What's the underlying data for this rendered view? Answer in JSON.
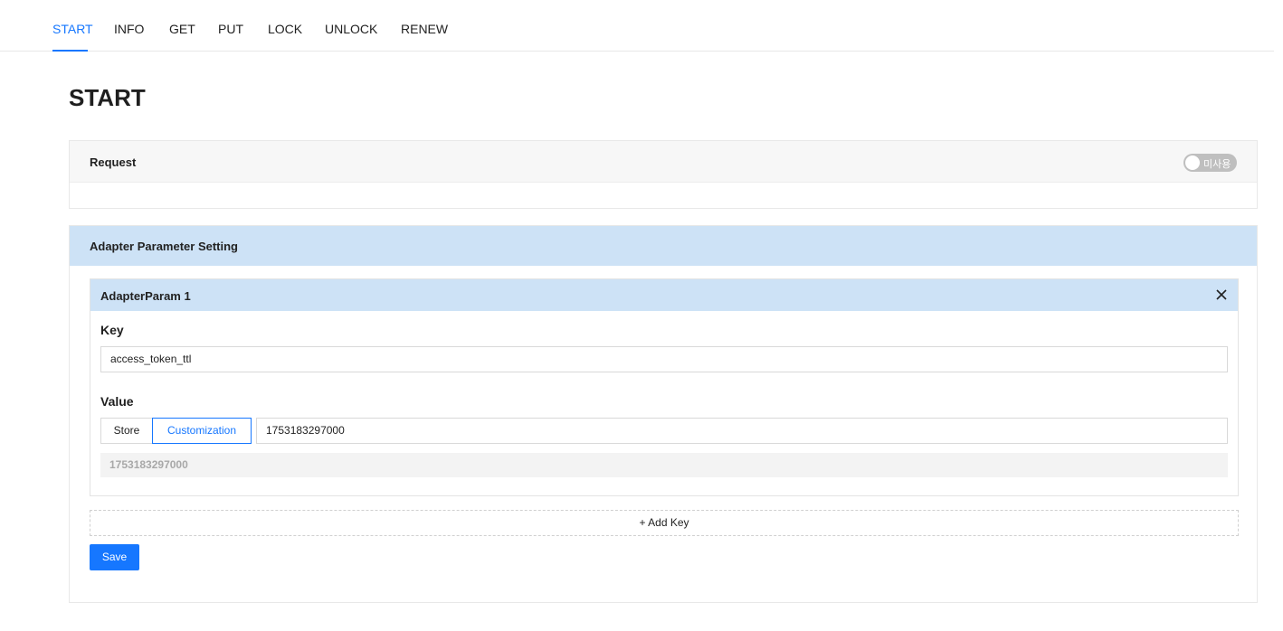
{
  "tabs": [
    {
      "label": "START",
      "active": true
    },
    {
      "label": "INFO"
    },
    {
      "label": "GET"
    },
    {
      "label": "PUT"
    },
    {
      "label": "LOCK"
    },
    {
      "label": "UNLOCK"
    },
    {
      "label": "RENEW"
    }
  ],
  "page_title": "START",
  "request": {
    "title": "Request",
    "toggle_label": "미사용",
    "toggle_on": false
  },
  "adapter": {
    "title": "Adapter Parameter Setting",
    "param": {
      "title": "AdapterParam 1",
      "close_icon": "close-icon",
      "key_label": "Key",
      "key_value": "access_token_ttl",
      "value_label": "Value",
      "segments": {
        "store": "Store",
        "customization": "Customization",
        "selected": "Customization"
      },
      "value_input": "1753183297000",
      "value_preview": "1753183297000"
    },
    "add_key_label": "+ Add Key",
    "save_label": "Save"
  },
  "colors": {
    "accent": "#1677ff",
    "header_blue": "#cde2f6",
    "toggle_off": "#bfbfbf"
  }
}
